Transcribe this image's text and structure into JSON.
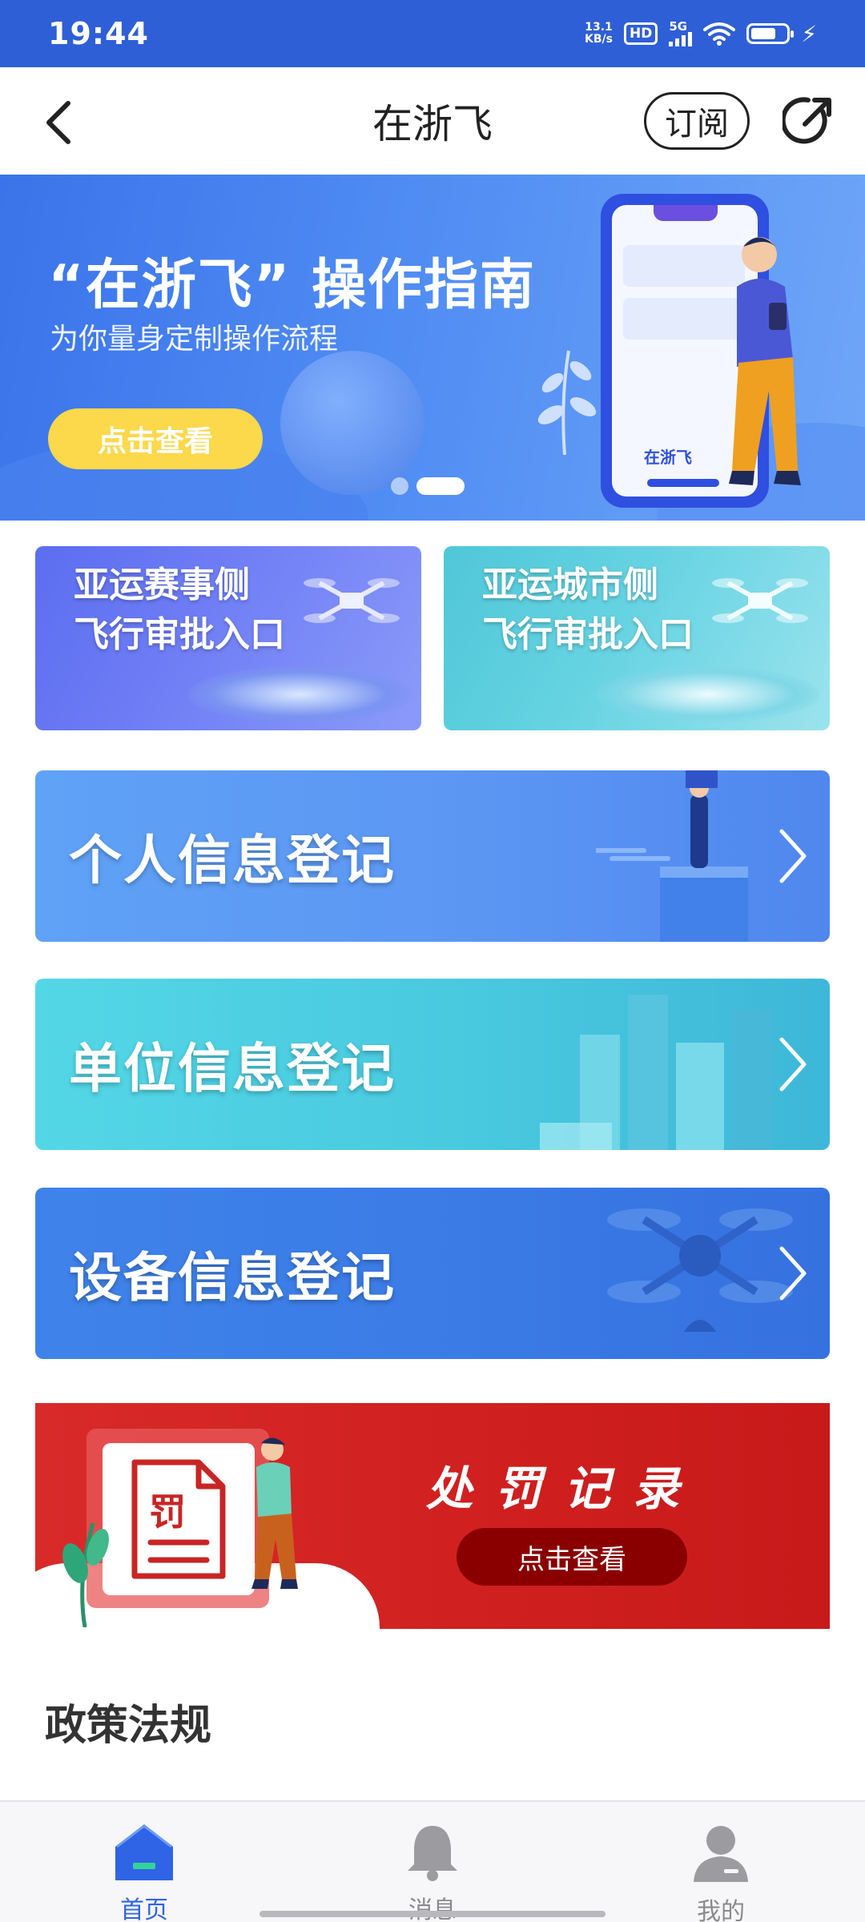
{
  "status_bar": {
    "time": "19:44",
    "net_speed_value": "13.1",
    "net_speed_unit": "KB/s",
    "hd": "HD",
    "signal": "5G"
  },
  "header": {
    "title": "在浙飞",
    "subscribe_label": "订阅"
  },
  "banner": {
    "title": "“在浙飞” 操作指南",
    "subtitle": "为你量身定制操作流程",
    "button_label": "点击查看",
    "phone_brand": "在浙飞",
    "slides_total": 2,
    "active_slide": 2
  },
  "approval_cards": [
    {
      "line1": "亚运赛事侧",
      "line2": "飞行审批入口"
    },
    {
      "line1": "亚运城市侧",
      "line2": "飞行审批入口"
    }
  ],
  "registration": [
    {
      "label": "个人信息登记"
    },
    {
      "label": "单位信息登记"
    },
    {
      "label": "设备信息登记"
    }
  ],
  "penalty": {
    "title": "处罚记录",
    "button_label": "点击查看",
    "doc_glyph": "罚"
  },
  "policy": {
    "title": "政策法规"
  },
  "tabbar": {
    "items": [
      {
        "label": "首页",
        "active": true
      },
      {
        "label": "消息",
        "active": false
      },
      {
        "label": "我的",
        "active": false
      }
    ]
  },
  "colors": {
    "status_bar": "#2f5fd6",
    "accent": "#2f64e6",
    "banner_button": "#fcd84b",
    "penalty_red": "#cf1f1f",
    "penalty_button": "#8a0000"
  }
}
